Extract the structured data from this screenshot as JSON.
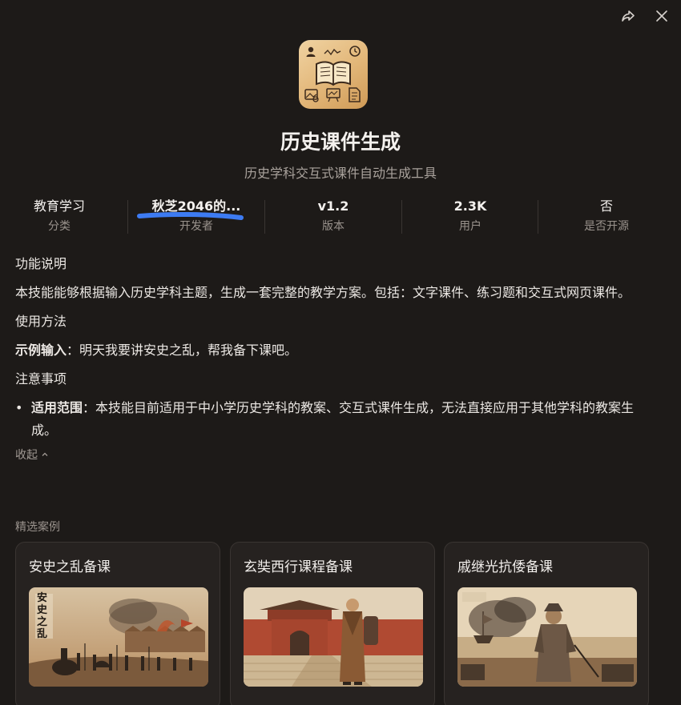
{
  "app": {
    "title": "历史课件生成",
    "subtitle": "历史学科交互式课件自动生成工具",
    "icon": "book-with-tools-icon"
  },
  "stats": [
    {
      "value": "教育学习",
      "label": "分类"
    },
    {
      "value": "秋芝2046的...",
      "label": "开发者"
    },
    {
      "value": "v1.2",
      "label": "版本"
    },
    {
      "value": "2.3K",
      "label": "用户"
    },
    {
      "value": "否",
      "label": "是否开源"
    }
  ],
  "description": {
    "feature_heading": "功能说明",
    "feature_text": "本技能能够根据输入历史学科主题，生成一套完整的教学方案。包括：文字课件、练习题和交互式网页课件。",
    "usage_heading": "使用方法",
    "example_label": "示例输入",
    "example_text": "：明天我要讲安史之乱，帮我备下课吧。",
    "notes_heading": "注意事项",
    "scope_label": "适用范围",
    "scope_text": "：本技能目前适用于中小学历史学科的教案、交互式课件生成，无法直接应用于其他学科的教案生成。",
    "collapse_label": "收起"
  },
  "cases": {
    "heading": "精选案例",
    "items": [
      {
        "title": "安史之乱备课",
        "image_caption": "安史之乱"
      },
      {
        "title": "玄奘西行课程备课"
      },
      {
        "title": "戚继光抗倭备课"
      }
    ]
  },
  "colors": {
    "background": "#1d1a18",
    "card": "#262220",
    "highlight": "#3d7bf2"
  }
}
